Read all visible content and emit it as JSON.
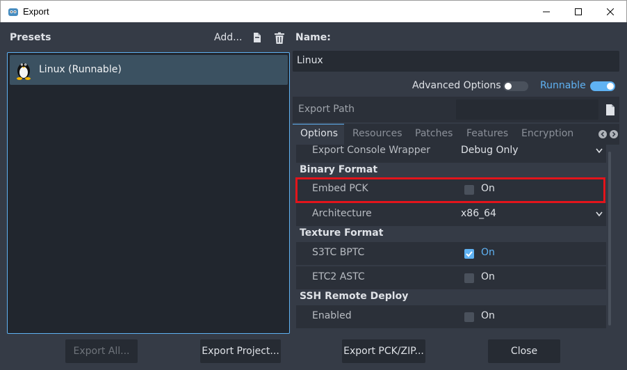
{
  "window": {
    "title": "Export"
  },
  "presets": {
    "label": "Presets",
    "add_label": "Add...",
    "items": [
      {
        "label": "Linux (Runnable)"
      }
    ]
  },
  "right": {
    "name_label": "Name:",
    "name_value": "Linux",
    "advanced_label": "Advanced Options",
    "advanced_on": false,
    "runnable_label": "Runnable",
    "runnable_on": true,
    "export_path_label": "Export Path",
    "export_path_value": ""
  },
  "tabs": [
    "Options",
    "Resources",
    "Patches",
    "Features",
    "Encryption"
  ],
  "options": {
    "export_console_wrapper": {
      "label": "Export Console Wrapper",
      "value": "Debug Only"
    },
    "section_binary": "Binary Format",
    "embed_pck": {
      "label": "Embed PCK",
      "value": "On",
      "checked": false
    },
    "architecture": {
      "label": "Architecture",
      "value": "x86_64"
    },
    "section_texture": "Texture Format",
    "s3tc": {
      "label": "S3TC BPTC",
      "value": "On",
      "checked": true
    },
    "etc2": {
      "label": "ETC2 ASTC",
      "value": "On",
      "checked": false
    },
    "section_ssh": "SSH Remote Deploy",
    "ssh_enabled": {
      "label": "Enabled",
      "value": "On",
      "checked": false
    }
  },
  "buttons": {
    "export_all": "Export All...",
    "export_project": "Export Project...",
    "export_pck": "Export PCK/ZIP...",
    "close": "Close"
  },
  "colors": {
    "accent": "#5fb2f3",
    "highlight": "#e3141b",
    "bg": "#353b46"
  }
}
